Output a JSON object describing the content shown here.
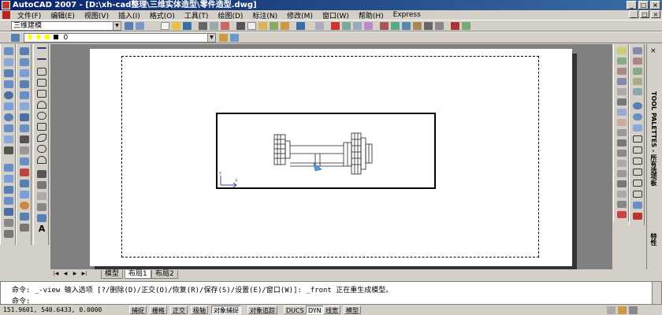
{
  "window": {
    "title": "AutoCAD 2007 - [D:\\xh-cad整理\\三维实体造型\\零件造型.dwg]",
    "controls": [
      "_",
      "□",
      "×"
    ],
    "doc_controls": [
      "_",
      "□",
      "×"
    ]
  },
  "menu": [
    "文件(F)",
    "编辑(E)",
    "视图(V)",
    "插入(I)",
    "格式(O)",
    "工具(T)",
    "绘图(D)",
    "标注(N)",
    "修改(M)",
    "窗口(W)",
    "帮助(H)",
    "Express"
  ],
  "toolbar": {
    "workspace": "三维建模",
    "layer": "0"
  },
  "drawing": {
    "ucs_x": "X",
    "ucs_y": "Y"
  },
  "tabs": {
    "nav": [
      "|◀",
      "◀",
      "▶",
      "▶|"
    ],
    "items": [
      "模型",
      "布局1",
      "布局2"
    ],
    "active_index": 1
  },
  "palette": {
    "close": "×",
    "label": "TOOL PALETTES - 所有选项板",
    "label2": "特性"
  },
  "command": {
    "line1": "命令: _-view 输入选项 [?/删除(D)/正交(O)/恢复(R)/保存(S)/设置(E)/窗口(W)]: _front 正在重生成模型。",
    "line2": "命令:"
  },
  "status": {
    "coords": "151.9601, 540.6433, 0.0000",
    "buttons": [
      "捕捉",
      "栅格",
      "正交",
      "极轴",
      "对象捕捉",
      "对象追踪",
      "DUCS",
      "DYN",
      "线宽",
      "模型"
    ],
    "active": [
      "对象捕捉",
      "DYN"
    ]
  },
  "colors": {
    "titlebar": "#0a246a",
    "chrome": "#d4d0c8",
    "canvas_bg": "#808080",
    "paper": "#ffffff"
  }
}
